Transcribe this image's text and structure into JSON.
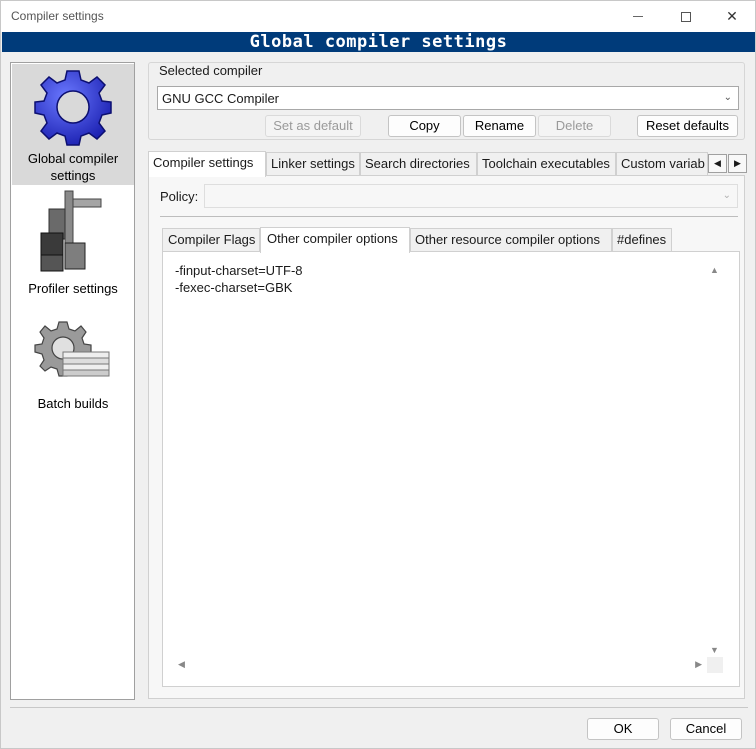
{
  "window": {
    "title": "Compiler settings",
    "banner": "Global compiler settings"
  },
  "sidebar": {
    "items": [
      {
        "label": "Global compiler settings",
        "icon": "gear-icon",
        "selected": true
      },
      {
        "label": "Profiler settings",
        "icon": "caliper-icon",
        "selected": false
      },
      {
        "label": "Batch builds",
        "icon": "batch-gear-icon",
        "selected": false
      }
    ]
  },
  "compiler": {
    "group_label": "Selected compiler",
    "selected": "GNU GCC Compiler",
    "buttons": {
      "set_default": "Set as default",
      "copy": "Copy",
      "rename": "Rename",
      "delete": "Delete",
      "reset": "Reset defaults"
    }
  },
  "tabs": [
    "Compiler settings",
    "Linker settings",
    "Search directories",
    "Toolchain executables",
    "Custom variab"
  ],
  "policy": {
    "label": "Policy:",
    "value": ""
  },
  "subtabs": [
    "Compiler Flags",
    "Other compiler options",
    "Other resource compiler options",
    "#defines"
  ],
  "editor": {
    "lines": [
      "-finput-charset=UTF-8",
      "-fexec-charset=GBK"
    ]
  },
  "footer": {
    "ok": "OK",
    "cancel": "Cancel"
  },
  "colors": {
    "banner_bg": "#003b7a",
    "banner_fg": "#ffffff"
  }
}
